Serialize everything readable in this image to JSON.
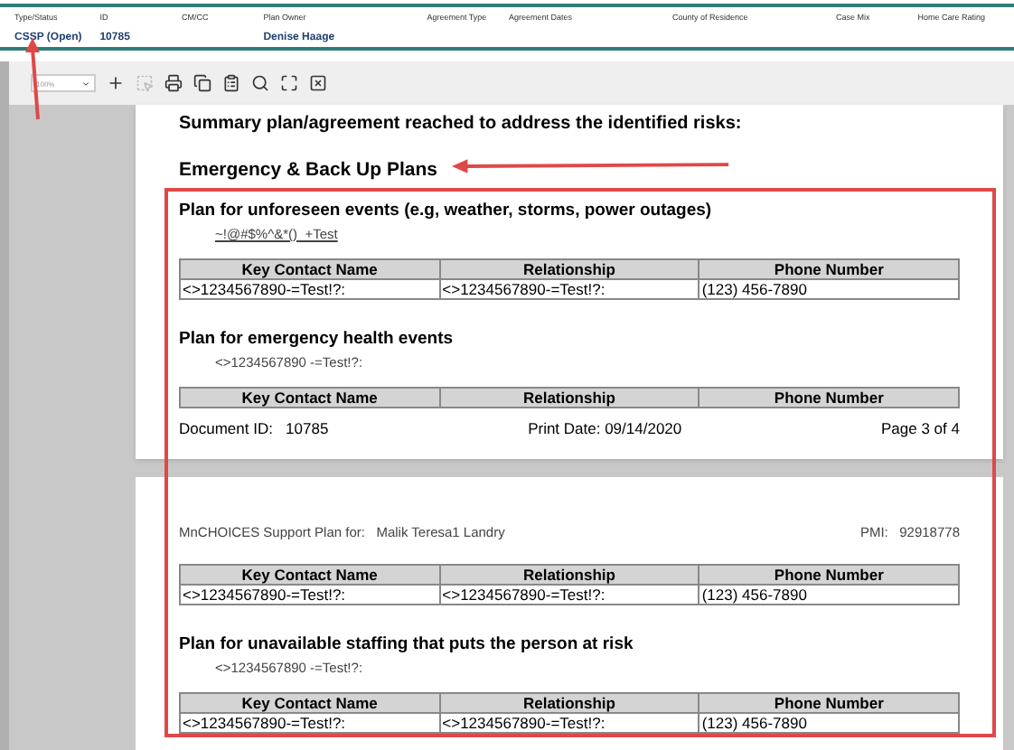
{
  "header": {
    "fields": [
      {
        "label": "Type/Status",
        "value": "CSSP (Open)"
      },
      {
        "label": "ID",
        "value": "10785"
      },
      {
        "label": "CM/CC"
      },
      {
        "label": "Plan Owner",
        "value": "Denise Haage"
      },
      {
        "label": "Agreement Type"
      },
      {
        "label": "Agreement Dates"
      },
      {
        "label": "County of Residence"
      },
      {
        "label": "Case Mix"
      },
      {
        "label": "Home Care Rating"
      }
    ]
  },
  "toolbar": {
    "zoom": "100%",
    "buttons": [
      {
        "kind": "plus",
        "disabled": false
      },
      {
        "kind": "select",
        "disabled": true
      },
      {
        "kind": "print",
        "disabled": false
      },
      {
        "kind": "print-page",
        "disabled": false
      },
      {
        "kind": "export",
        "disabled": false
      },
      {
        "kind": "search",
        "disabled": false
      },
      {
        "kind": "fullscreen",
        "disabled": false
      },
      {
        "kind": "close",
        "disabled": false
      }
    ]
  },
  "pages": [
    {
      "blocks": [
        {
          "kind": "text",
          "text": "Summary plan/agreement reached to address the identified risks:"
        },
        {
          "kind": "section",
          "text": "Emergency & Back Up Plans"
        },
        {
          "kind": "plan",
          "title": "Plan for unforeseen events (e.g, weather, storms, power outages)",
          "note": "~!@#$%^&*()_+Test",
          "note_link": true,
          "columns": [
            "Key Contact Name",
            "Relationship",
            "Phone Number"
          ],
          "rows": [
            [
              "<>1234567890-=Test!?:",
              "<>1234567890-=Test!?:",
              "(123) 456-7890"
            ]
          ]
        },
        {
          "kind": "plan",
          "title": "Plan for emergency health events",
          "note": "<>1234567890 -=Test!?:",
          "note_link": false,
          "columns": [
            "Key Contact Name",
            "Relationship",
            "Phone Number"
          ]
        }
      ],
      "footer": {
        "document_id_label": "Document ID:",
        "document_id": "10785",
        "print_date": "Print Date: 09/14/2020",
        "page": "Page 3 of 4"
      }
    },
    {
      "header": {
        "plan_for_label": "MnCHOICES Support Plan for:",
        "person": "Malik Teresa1 Landry",
        "pmi_label": "PMI:",
        "pmi": "92918778"
      },
      "blocks": [
        {
          "kind": "plan",
          "columns": [
            "Key Contact Name",
            "Relationship",
            "Phone Number"
          ],
          "rows": [
            [
              "<>1234567890-=Test!?:",
              "<>1234567890-=Test!?:",
              "(123) 456-7890"
            ]
          ]
        },
        {
          "kind": "plan",
          "title": "Plan for unavailable staffing that puts the person at risk",
          "note": "<>1234567890 -=Test!?:",
          "note_link": false,
          "columns": [
            "Key Contact Name",
            "Relationship",
            "Phone Number"
          ],
          "rows": [
            [
              "<>1234567890-=Test!?:",
              "<>1234567890-=Test!?:",
              "(123) 456-7890"
            ]
          ]
        }
      ]
    }
  ]
}
